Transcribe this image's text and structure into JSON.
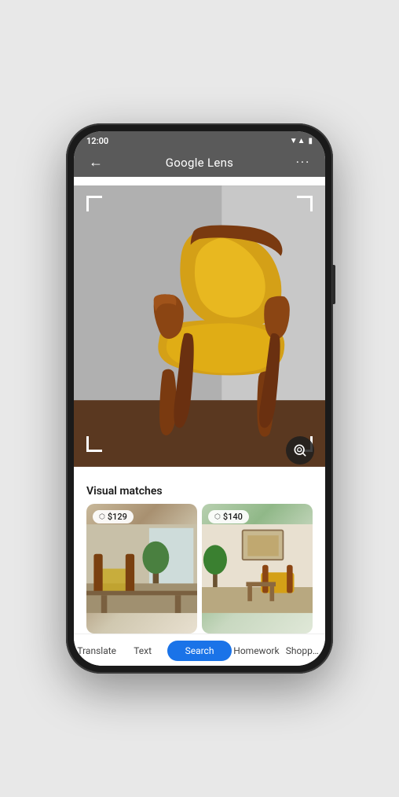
{
  "status_bar": {
    "time": "12:00",
    "signal": "▼▲",
    "wifi": "▲",
    "battery": "▮"
  },
  "top_bar": {
    "title": "Google Lens",
    "back_label": "←",
    "more_label": "···"
  },
  "image": {
    "alt": "Yellow mid-century modern chair with wooden frame on dark floor"
  },
  "results": {
    "section_title": "Visual matches",
    "matches": [
      {
        "price": "$129",
        "alt": "Similar yellow chair in room setting"
      },
      {
        "price": "$140",
        "alt": "Similar chair with wooden table"
      }
    ]
  },
  "tabs": [
    {
      "id": "translate",
      "label": "Translate",
      "active": false
    },
    {
      "id": "text",
      "label": "Text",
      "active": false
    },
    {
      "id": "search",
      "label": "Search",
      "active": true
    },
    {
      "id": "homework",
      "label": "Homework",
      "active": false
    },
    {
      "id": "shopping",
      "label": "Shopp…",
      "active": false
    }
  ]
}
